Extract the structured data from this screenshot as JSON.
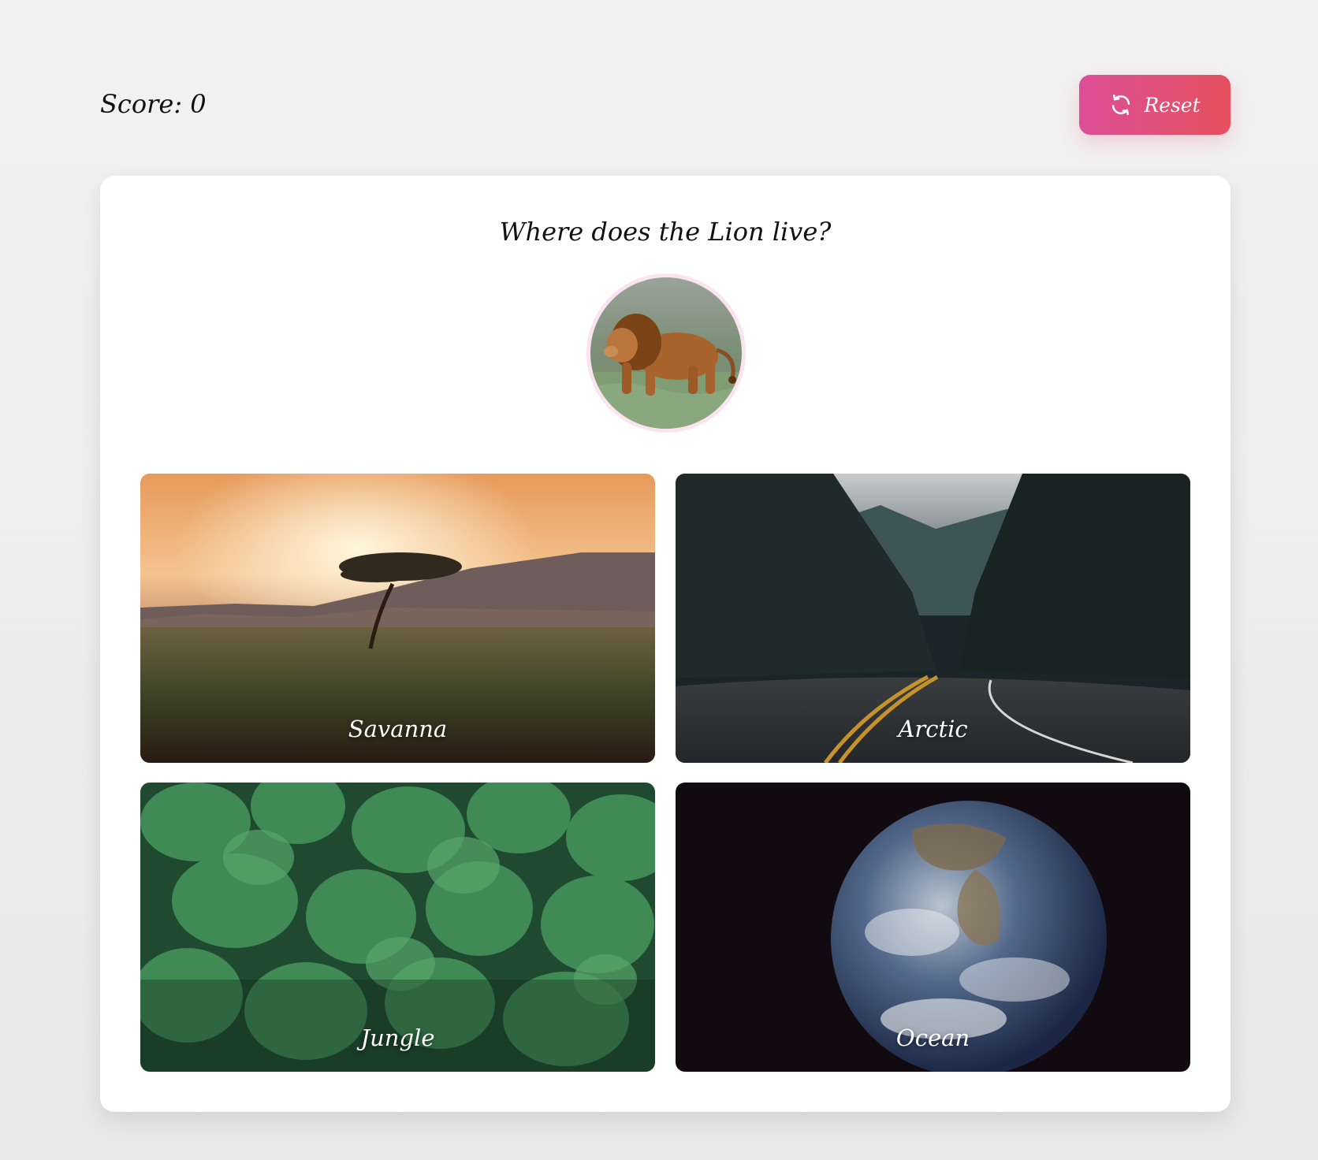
{
  "header": {
    "score_text": "Score: 0",
    "reset_label": "Reset",
    "reset_icon": "refresh-icon",
    "reset_gradient": [
      "#dc4f97",
      "#e6505f"
    ]
  },
  "question": {
    "text": "Where does the Lion live?",
    "animal_image": "lion-image"
  },
  "options": [
    {
      "label": "Savanna",
      "image": "savanna-image"
    },
    {
      "label": "Arctic",
      "image": "arctic-image"
    },
    {
      "label": "Jungle",
      "image": "jungle-image"
    },
    {
      "label": "Ocean",
      "image": "ocean-image"
    }
  ]
}
